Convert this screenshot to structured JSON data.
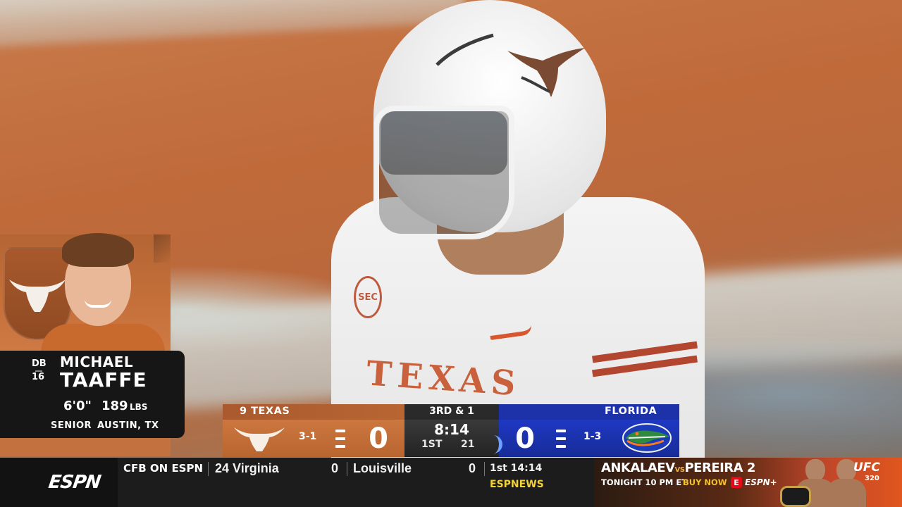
{
  "player_card": {
    "position": "DB",
    "number": "16",
    "first_name": "MICHAEL",
    "last_name": "TAAFFE",
    "height": "6'0\"",
    "weight": "189",
    "weight_unit": "LBS",
    "class_year": "SENIOR",
    "hometown": "AUSTIN, TX",
    "team_logo_icon": "longhorn-icon"
  },
  "scorebug": {
    "away": {
      "name": "9 TEXAS",
      "record": "3-1",
      "score": "0",
      "timeouts": 3,
      "logo_icon": "longhorn-icon",
      "color": "#bf6530"
    },
    "home": {
      "name": "FLORIDA",
      "record": "1-3",
      "score": "0",
      "timeouts": 3,
      "logo_icon": "gator-icon",
      "color": "#1f38c2"
    },
    "situation": "3RD & 1",
    "clock": "8:14",
    "quarter": "1ST",
    "play_clock": "21"
  },
  "ticker": {
    "network_logo": "ESPN",
    "category": "CFB ON ESPN",
    "team1": "24 Virginia",
    "team1_score": "0",
    "team2": "Louisville",
    "team2_score": "0",
    "game_time": "1st 14:14",
    "network": "ESPNEWS"
  },
  "promo": {
    "fighter1": "ANKALAEV",
    "vs": "VS",
    "fighter2": "PEREIRA 2",
    "time": "TONIGHT 10 PM ET",
    "cta": "BUY NOW",
    "eplus_icon": "E",
    "service": "ESPN+",
    "brand": "UFC",
    "event_number": "320"
  }
}
